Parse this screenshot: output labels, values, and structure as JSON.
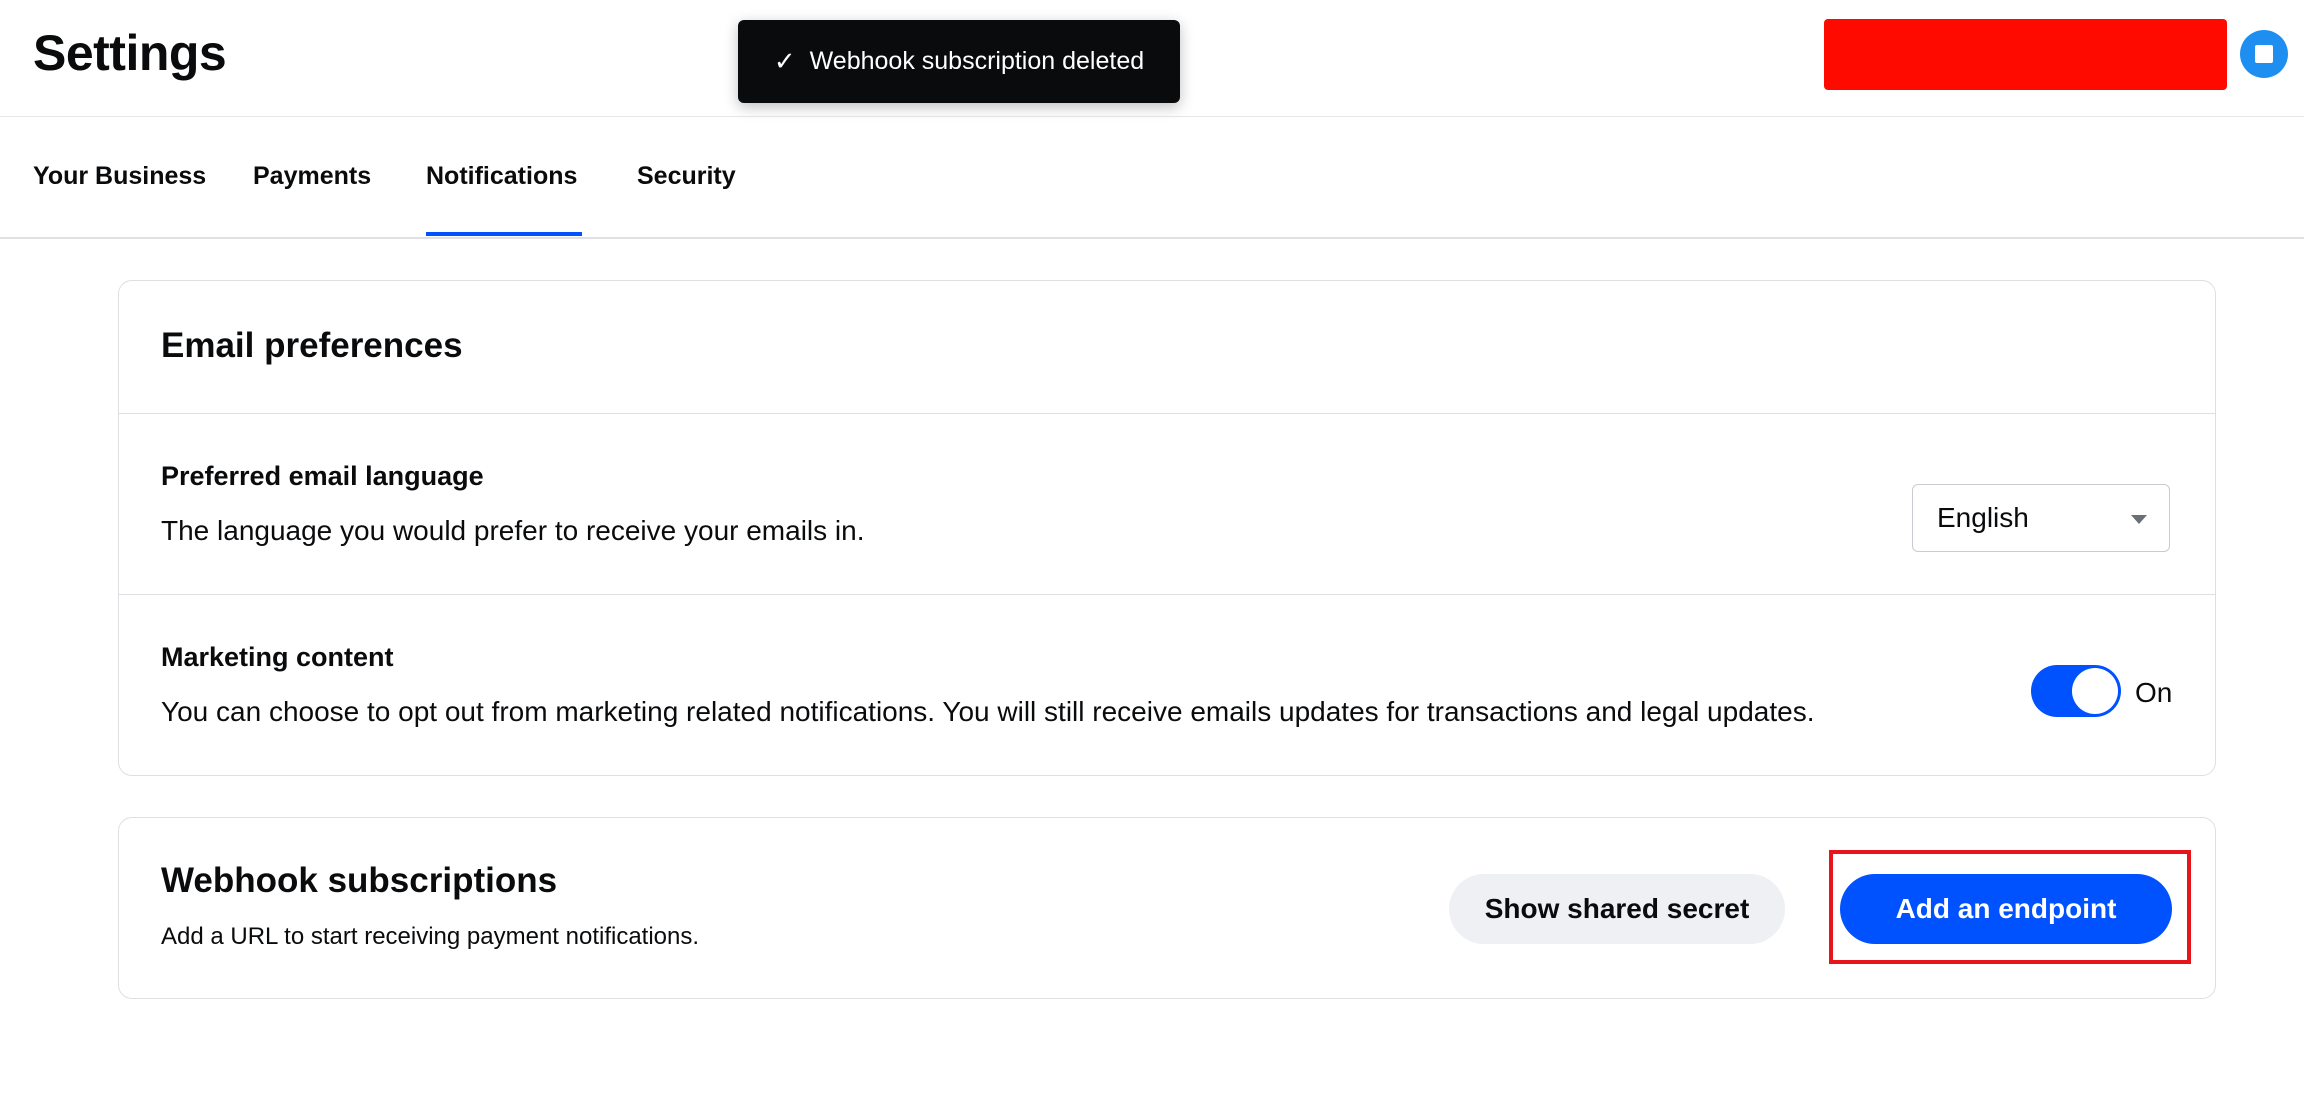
{
  "header": {
    "title": "Settings"
  },
  "toast": {
    "message": "Webhook subscription deleted",
    "icon": "checkmark-icon"
  },
  "tabs": [
    {
      "label": "Your Business",
      "active": false
    },
    {
      "label": "Payments",
      "active": false
    },
    {
      "label": "Notifications",
      "active": true
    },
    {
      "label": "Security",
      "active": false
    }
  ],
  "email_preferences": {
    "heading": "Email preferences",
    "language": {
      "title": "Preferred email language",
      "description": "The language you would prefer to receive your emails in.",
      "selected": "English"
    },
    "marketing": {
      "title": "Marketing content",
      "description": "You can choose to opt out from marketing related notifications. You will still receive emails updates for transactions and legal updates.",
      "toggle_state": "On"
    }
  },
  "webhooks": {
    "heading": "Webhook subscriptions",
    "description": "Add a URL to start receiving payment notifications.",
    "show_secret_label": "Show shared secret",
    "add_endpoint_label": "Add an endpoint"
  },
  "colors": {
    "accent": "#0052ff",
    "redaction": "#ff0a00",
    "highlight": "#e8141b",
    "toast_bg": "#0a0b0d"
  }
}
